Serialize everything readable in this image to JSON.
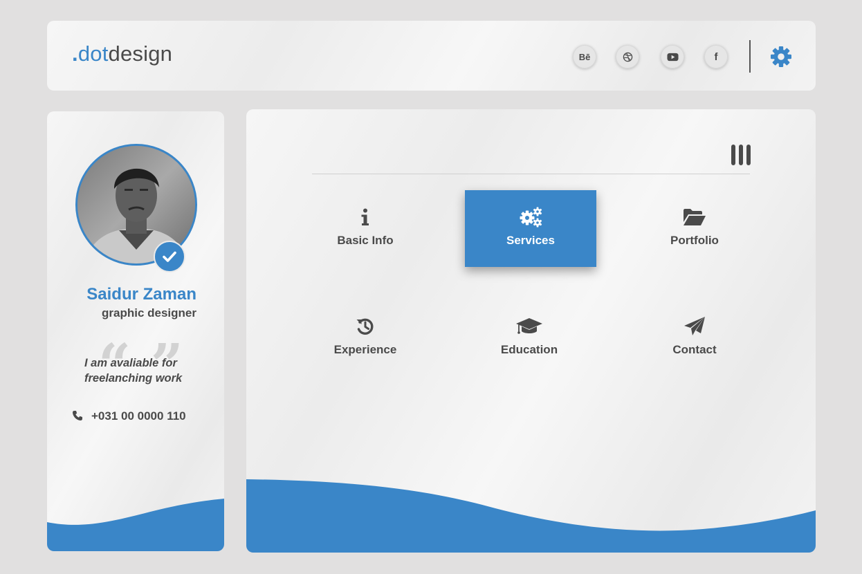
{
  "brand": {
    "prefix": ".",
    "accent": "dot",
    "suffix": "design"
  },
  "header": {
    "social": [
      {
        "name": "behance-icon",
        "label": "Bē"
      },
      {
        "name": "dribbble-icon",
        "label": ""
      },
      {
        "name": "youtube-icon",
        "label": ""
      },
      {
        "name": "facebook-icon",
        "label": "f"
      }
    ],
    "settings_icon": "gear-icon"
  },
  "profile": {
    "name": "Saidur Zaman",
    "role": "graphic designer",
    "quote_line1": "I am avaliable for",
    "quote_line2": "freelanching work",
    "phone": "+031 00 0000 110",
    "verified": true
  },
  "menu": {
    "items": [
      {
        "label": "Basic Info",
        "icon": "info-icon",
        "active": false
      },
      {
        "label": "Services",
        "icon": "gears-icon",
        "active": true
      },
      {
        "label": "Portfolio",
        "icon": "folder-open-icon",
        "active": false
      },
      {
        "label": "Experience",
        "icon": "history-icon",
        "active": false
      },
      {
        "label": "Education",
        "icon": "graduation-cap-icon",
        "active": false
      },
      {
        "label": "Contact",
        "icon": "paper-plane-icon",
        "active": false
      }
    ]
  },
  "colors": {
    "accent": "#3a86c8",
    "text": "#4a4a4a",
    "background": "#e1e0e0"
  }
}
